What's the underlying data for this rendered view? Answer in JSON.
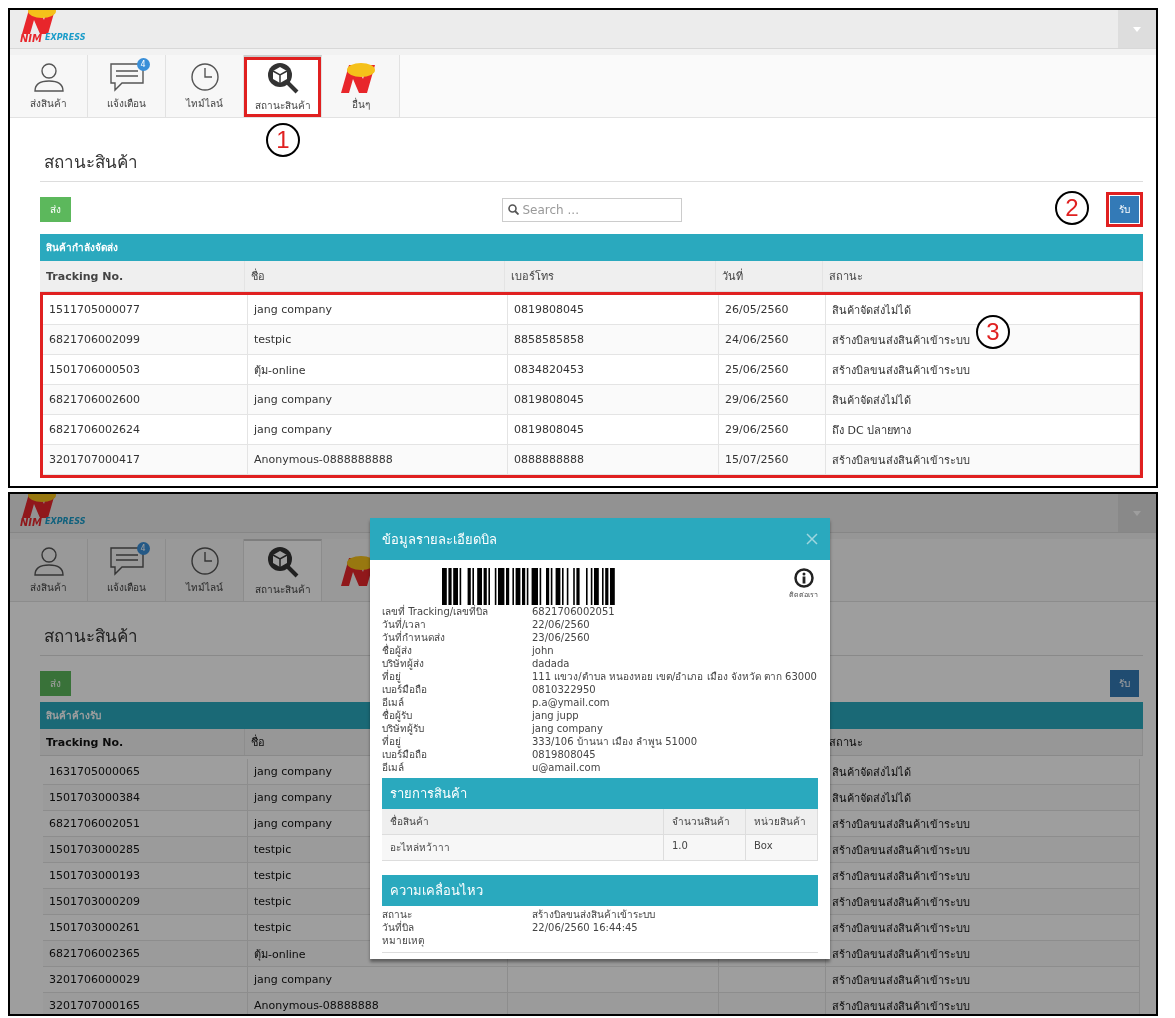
{
  "screens": [
    {
      "dimmed": false,
      "logo": {
        "mark": "NIM",
        "word": "EXPRESS"
      },
      "tabs": [
        {
          "kind": "person",
          "label": "ส่งสินค้า",
          "selected": false,
          "highlighted": false
        },
        {
          "kind": "chat",
          "label": "แจ้งเตือน",
          "badge": "4",
          "selected": false,
          "highlighted": false
        },
        {
          "kind": "clock",
          "label": "ไทม์ไลน์",
          "selected": false,
          "highlighted": false
        },
        {
          "kind": "box-search",
          "label": "สถานะสินค้า",
          "selected": true,
          "highlighted": true,
          "annotation": "1"
        },
        {
          "kind": "mascot",
          "label": "อื่นๆ",
          "selected": false,
          "highlighted": false
        }
      ],
      "page_title": "สถานะสินค้า",
      "send_button": {
        "label": "ส่ง"
      },
      "search": {
        "placeholder": "Search ..."
      },
      "receive_button": {
        "label": "รับ",
        "highlighted": true,
        "annotation": "2"
      },
      "table": {
        "title": "สินค้ากำลังจัดส่ง",
        "rows_highlighted": true,
        "rows_annotation": "3",
        "columns": [
          "Tracking No.",
          "ชื่อ",
          "เบอร์โทร",
          "วันที่",
          "สถานะ"
        ],
        "rows": [
          [
            "1511705000077",
            "jang company",
            "0819808045",
            "26/05/2560",
            "สินค้าจัดส่งไม่ได้"
          ],
          [
            "6821706002099",
            "testpic",
            "8858585858",
            "24/06/2560",
            "สร้างบิลขนส่งสินค้าเข้าระบบ"
          ],
          [
            "1501706000503",
            "ตุ้ม-online",
            "0834820453",
            "25/06/2560",
            "สร้างบิลขนส่งสินค้าเข้าระบบ"
          ],
          [
            "6821706002600",
            "jang company",
            "0819808045",
            "29/06/2560",
            "สินค้าจัดส่งไม่ได้"
          ],
          [
            "6821706002624",
            "jang company",
            "0819808045",
            "29/06/2560",
            "ถึง DC ปลายทาง"
          ],
          [
            "3201707000417",
            "Anonymous-0888888888",
            "0888888888",
            "15/07/2560",
            "สร้างบิลขนส่งสินค้าเข้าระบบ"
          ]
        ]
      }
    },
    {
      "dimmed": true,
      "logo": {
        "mark": "NIM",
        "word": "EXPRESS"
      },
      "tabs": [
        {
          "kind": "person",
          "label": "ส่งสินค้า",
          "selected": false,
          "highlighted": false
        },
        {
          "kind": "chat",
          "label": "แจ้งเตือน",
          "badge": "4",
          "selected": false,
          "highlighted": false
        },
        {
          "kind": "clock",
          "label": "ไทม์ไลน์",
          "selected": false,
          "highlighted": false
        },
        {
          "kind": "box-search",
          "label": "สถานะสินค้า",
          "selected": true,
          "highlighted": false
        },
        {
          "kind": "mascot",
          "selected": false,
          "highlighted": false
        }
      ],
      "page_title": "สถานะสินค้า",
      "send_button": {
        "label": "ส่ง"
      },
      "receive_button": {
        "label": "รับ",
        "highlighted": false
      },
      "table": {
        "title": "สินค้าค้างรับ",
        "rows_highlighted": false,
        "columns": [
          "Tracking No.",
          "ชื่อ",
          "สถานะ"
        ],
        "rows": [
          [
            "1631705000065",
            "jang company",
            "สินค้าจัดส่งไม่ได้"
          ],
          [
            "1501703000384",
            "jang company",
            "สินค้าจัดส่งไม่ได้"
          ],
          [
            "6821706002051",
            "jang company",
            "สร้างบิลขนส่งสินค้าเข้าระบบ"
          ],
          [
            "1501703000285",
            "testpic",
            "สร้างบิลขนส่งสินค้าเข้าระบบ"
          ],
          [
            "1501703000193",
            "testpic",
            "สร้างบิลขนส่งสินค้าเข้าระบบ"
          ],
          [
            "1501703000209",
            "testpic",
            "สร้างบิลขนส่งสินค้าเข้าระบบ"
          ],
          [
            "1501703000261",
            "testpic",
            "สร้างบิลขนส่งสินค้าเข้าระบบ"
          ],
          [
            "6821706002365",
            "ตุ้ม-online",
            "สร้างบิลขนส่งสินค้าเข้าระบบ"
          ],
          [
            "3201706000029",
            "jang company",
            "สร้างบิลขนส่งสินค้าเข้าระบบ"
          ],
          [
            "3201707000165",
            "Anonymous-08888888",
            "สร้างบิลขนส่งสินค้าเข้าระบบ"
          ]
        ]
      },
      "modal": {
        "title": "ข้อมูลรายละเอียดบิล",
        "contact_label": "ติดต่อเรา",
        "details": [
          {
            "label": "เลขที่ Tracking/เลขที่บิล",
            "value": "6821706002051"
          },
          {
            "label": "วันที่/เวลา",
            "value": "22/06/2560"
          },
          {
            "label": "วันที่กำหนดส่ง",
            "value": "23/06/2560"
          },
          {
            "label": "ชื่อผู้ส่ง",
            "value": "john"
          },
          {
            "label": "บริษัทผู้ส่ง",
            "value": "dadada"
          },
          {
            "label": "ที่อยู่",
            "value": "111 แขวง/ตำบล หนองหอย เขต/อำเภอ เมือง จังหวัด ตาก 63000"
          },
          {
            "label": "เบอร์มือถือ",
            "value": "0810322950"
          },
          {
            "label": "อีเมล์",
            "value": "p.a@ymail.com"
          },
          {
            "label": "ชื่อผู้รับ",
            "value": "jang jupp"
          },
          {
            "label": "บริษัทผู้รับ",
            "value": "jang company"
          },
          {
            "label": "ที่อยู่",
            "value": "333/106 บ้านนา เมือง ลำพูน 51000"
          },
          {
            "label": "เบอร์มือถือ",
            "value": "0819808045"
          },
          {
            "label": "อีเมล์",
            "value": "u@amail.com"
          }
        ],
        "items_section": {
          "title": "รายการสินค้า",
          "columns": [
            "ชื่อสินค้า",
            "จำนวนสินค้า",
            "หน่วยสินค้า"
          ],
          "rows": [
            [
              "อะไหล่หว้าาา",
              "1.0",
              "Box"
            ]
          ]
        },
        "movement_section": {
          "title": "ความเคลื่อนไหว",
          "details": [
            {
              "label": "สถานะ",
              "value": "สร้างบิลขนส่งสินค้าเข้าระบบ"
            },
            {
              "label": "วันที่บิล",
              "value": "22/06/2560 16:44:45"
            },
            {
              "label": "หมายเหตุ"
            }
          ]
        }
      }
    }
  ]
}
